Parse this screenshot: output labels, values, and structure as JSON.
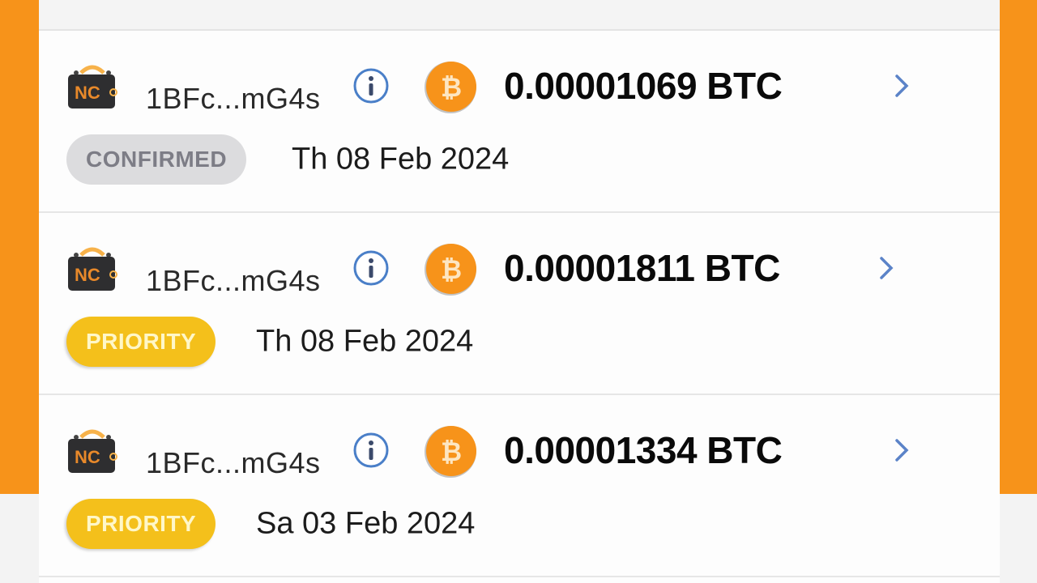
{
  "colors": {
    "brand_orange": "#f7931a",
    "priority_yellow": "#f4c01b",
    "confirmed_gray": "#dcdcde",
    "info_blue": "#4a7fc8",
    "chevron_blue": "#5b83c8"
  },
  "transactions": [
    {
      "wallet_icon": "nc-wallet-icon",
      "wallet_label": "NC",
      "address": "1BFc...mG4s",
      "info_icon": "info-icon",
      "coin_icon": "bitcoin-icon",
      "coin_glyph": "₿",
      "amount": "0.00001069 BTC",
      "status": "CONFIRMED",
      "date": "Th 08 Feb 2024"
    },
    {
      "wallet_icon": "nc-wallet-icon",
      "wallet_label": "NC",
      "address": "1BFc...mG4s",
      "info_icon": "info-icon",
      "coin_icon": "bitcoin-icon",
      "coin_glyph": "₿",
      "amount": "0.00001811 BTC",
      "status": "PRIORITY",
      "date": "Th 08 Feb 2024"
    },
    {
      "wallet_icon": "nc-wallet-icon",
      "wallet_label": "NC",
      "address": "1BFc...mG4s",
      "info_icon": "info-icon",
      "coin_icon": "bitcoin-icon",
      "coin_glyph": "₿",
      "amount": "0.00001334 BTC",
      "status": "PRIORITY",
      "date": "Sa 03 Feb 2024"
    }
  ]
}
